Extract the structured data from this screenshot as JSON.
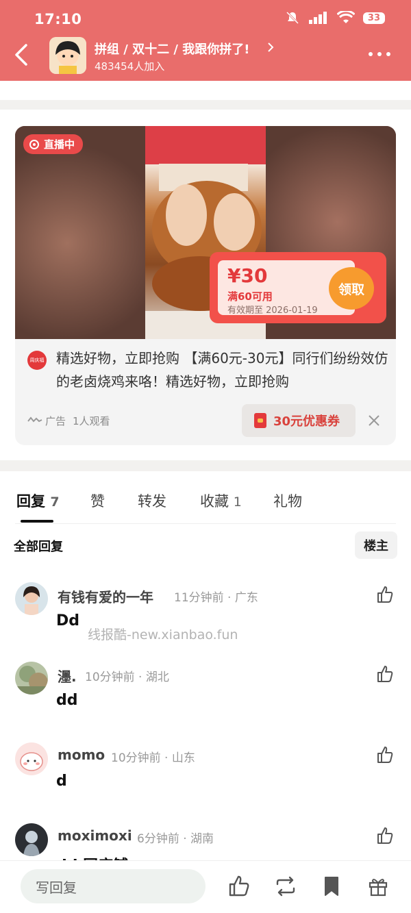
{
  "status_bar": {
    "time": "17:10",
    "battery": "33"
  },
  "header": {
    "group_name": "拼组 / 双十二 / 我跟你拼了!",
    "member_count": "483454人加入"
  },
  "ad": {
    "live_label": "直播中",
    "coupon": {
      "price": "¥30",
      "condition": "满60可用",
      "expiry": "有效期至 2026-01-19",
      "claim_label": "领取"
    },
    "brand_logo_text": "周庆福",
    "text": "精选好物，立即抢购 【满60元-30元】同行们纷纷效仿的老卤烧鸡来咯！精选好物，立即抢购",
    "ad_label": "广告",
    "viewers": "1人观看",
    "coupon_button_label": "30元优惠券"
  },
  "tabs": [
    {
      "label": "回复",
      "count": "7"
    },
    {
      "label": "赞",
      "count": ""
    },
    {
      "label": "转发",
      "count": ""
    },
    {
      "label": "收藏",
      "count": "1"
    },
    {
      "label": "礼物",
      "count": ""
    }
  ],
  "replies_section": {
    "title": "全部回复",
    "filter_label": "楼主"
  },
  "comments": [
    {
      "name": "有钱有爱的一年",
      "meta": "11分钟前 · 广东",
      "text": "Dd"
    },
    {
      "name": "濹.",
      "meta": "10分钟前 · 湖北",
      "text": "dd"
    },
    {
      "name": "momo",
      "meta": "10分钟前 · 山东",
      "text": "d"
    },
    {
      "name": "moximoxi",
      "meta": "6分钟前 · 湖南",
      "text": "dd 同店铺"
    }
  ],
  "watermark": "线报酷-new.xianbao.fun",
  "bottom_bar": {
    "reply_placeholder": "写回复"
  },
  "colors": {
    "header_bg": "#e96d6b",
    "accent_red": "#e3393b",
    "claim_orange": "#f79b2e"
  }
}
